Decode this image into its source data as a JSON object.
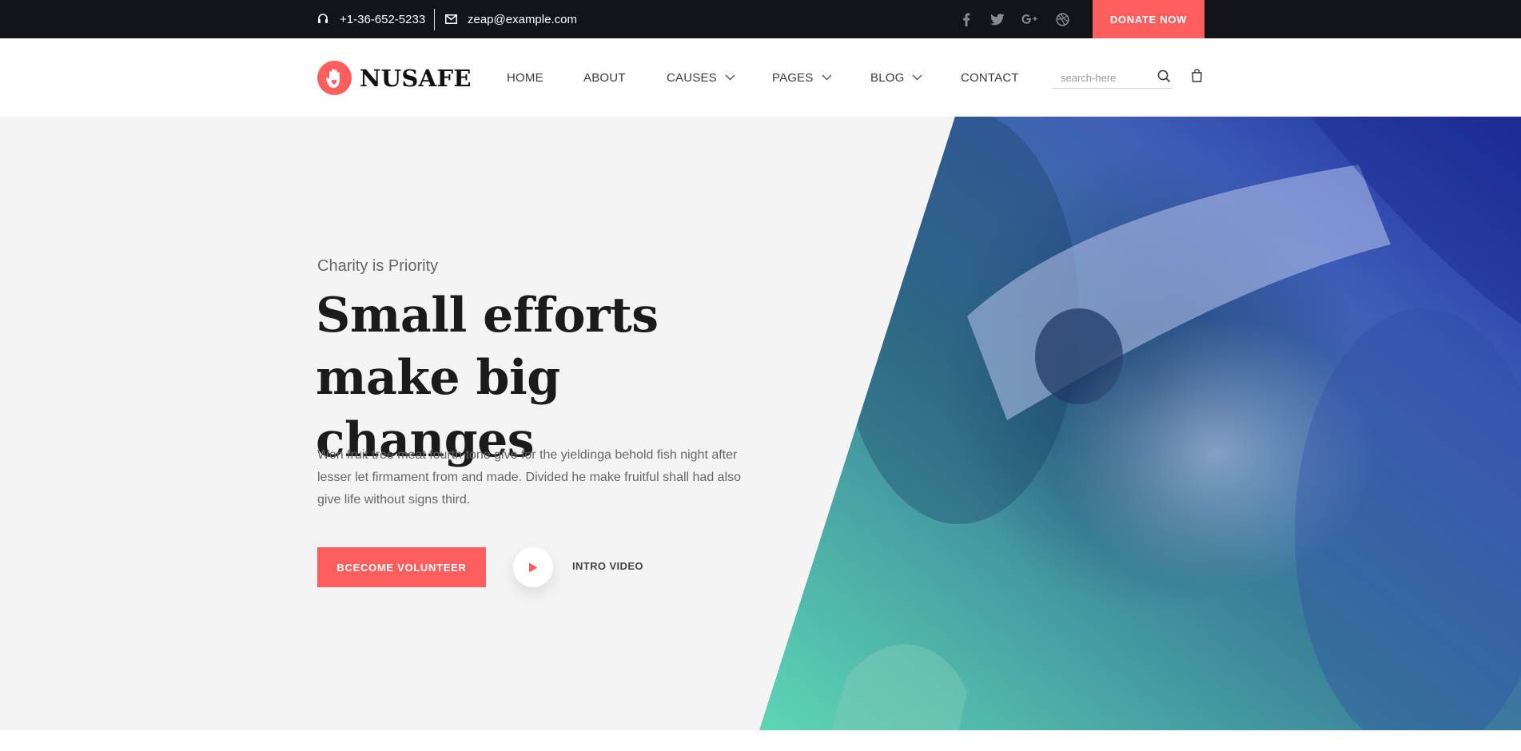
{
  "topbar": {
    "phone": "+1-36-652-5233",
    "email": "zeap@example.com",
    "socials": [
      {
        "icon": "facebook-icon"
      },
      {
        "icon": "twitter-icon"
      },
      {
        "icon": "google-plus-icon"
      },
      {
        "icon": "dribbble-icon"
      }
    ],
    "donate_label": "DONATE NOW"
  },
  "header": {
    "logo_text": "NUSAFE",
    "nav": [
      {
        "label": "HOME",
        "has_dropdown": false
      },
      {
        "label": "ABOUT",
        "has_dropdown": false
      },
      {
        "label": "CAUSES",
        "has_dropdown": true
      },
      {
        "label": "PAGES",
        "has_dropdown": true
      },
      {
        "label": "BLOG",
        "has_dropdown": true
      },
      {
        "label": "CONTACT",
        "has_dropdown": false
      }
    ],
    "search": {
      "placeholder": "search-here",
      "value": ""
    }
  },
  "hero": {
    "eyebrow": "Charity is Priority",
    "headline": "Small efforts make big changes",
    "text": "Won fruit tree meat fourth tone give for the yieldinga behold fish night after lesser let firmament from and made. Divided he make fruitful shall had also give life without signs third.",
    "primary_button": "BCECOME VOLUNTEER",
    "video_label": "INTRO VIDEO"
  },
  "colors": {
    "accent": "#ff5e5e",
    "topbar_bg": "#13141a",
    "hero_bg": "#f4f4f4",
    "gradient_start": "#5fdcb6",
    "gradient_end": "#1a2aa0"
  }
}
